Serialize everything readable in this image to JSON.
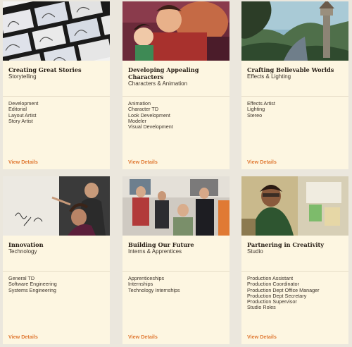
{
  "cards": [
    {
      "title": "Creating Great Stories",
      "subtitle": "Storytelling",
      "roles": [
        "Development",
        "Editorial",
        "Layout Artist",
        "Story Artist"
      ],
      "link": "View Details"
    },
    {
      "title": "Developing Appealing Characters",
      "subtitle": "Characters & Animation",
      "roles": [
        "Animation",
        "Character TD",
        "Look Development",
        "Modeler",
        "Visual Development"
      ],
      "link": "View Details"
    },
    {
      "title": "Crafting Believable Worlds",
      "subtitle": "Effects & Lighting",
      "roles": [
        "Effects Artist",
        "Lighting",
        "Stereo"
      ],
      "link": "View Details"
    },
    {
      "title": "Innovation",
      "subtitle": "Technology",
      "roles": [
        "General TD",
        "Software Engineering",
        "Systems Engineering"
      ],
      "link": "View Details"
    },
    {
      "title": "Building Our Future",
      "subtitle": "Interns & Apprentices",
      "roles": [
        "Apprenticeships",
        "Internships",
        "Technology Internships"
      ],
      "link": "View Details"
    },
    {
      "title": "Partnering in Creativity",
      "subtitle": "Studio",
      "roles": [
        "Production Assistant",
        "Production Coordinator",
        "Production Dept Office Manager",
        "Production Dept Secretary",
        "Production Supervisor",
        "Studio Roles"
      ],
      "link": "View Details"
    }
  ],
  "colors": {
    "page_bg": "#ebe7dd",
    "card_bg": "#fdf6e1",
    "link": "#e07a34",
    "title": "#2a2118"
  }
}
